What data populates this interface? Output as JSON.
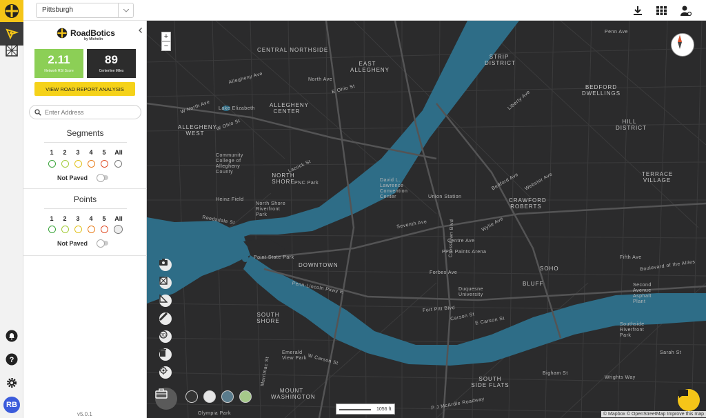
{
  "topbar": {
    "city": "Pittsburgh",
    "icons": [
      "download-icon",
      "grid-icon",
      "user-settings-icon"
    ]
  },
  "panel": {
    "brand_name": "RoadBotics",
    "brand_sub": "by Michelin",
    "stats": [
      {
        "value": "2.11",
        "label": "Network RSI Score",
        "color": "#8ccf56"
      },
      {
        "value": "89",
        "label": "Centerline Miles",
        "color": "#2c2c2c"
      }
    ],
    "report_button": "VIEW ROAD REPORT ANALYSIS",
    "address_placeholder": "Enter Address",
    "segments": {
      "title": "Segments",
      "levels": [
        "1",
        "2",
        "3",
        "4",
        "5",
        "All"
      ],
      "colors": [
        "#3aa43a",
        "#a4cc3a",
        "#e2c21d",
        "#e87f1e",
        "#e0502a",
        "#7a7a7a"
      ],
      "toggle_label": "Not Paved"
    },
    "points": {
      "title": "Points",
      "levels": [
        "1",
        "2",
        "3",
        "4",
        "5",
        "All"
      ],
      "colors": [
        "#3aa43a",
        "#a4cc3a",
        "#e2c21d",
        "#e87f1e",
        "#e0502a",
        "#7a7a7a"
      ],
      "toggle_label": "Not Paved"
    },
    "version": "v5.0.1"
  },
  "rail": {
    "avatar": "RB"
  },
  "map": {
    "zoom_in": "+",
    "zoom_out": "−",
    "scale": "1056 ft",
    "attribution": "© Mapbox © OpenStreetMap  Improve this map",
    "colors": {
      "land": "#2b2b2c",
      "water": "#2e6d87",
      "road": "#454545"
    },
    "labels": [
      {
        "text": "CENTRAL NORTHSIDE",
        "big": true
      },
      {
        "text": "EAST ALLEGHENY",
        "big": true
      },
      {
        "text": "STRIP DISTRICT",
        "big": true
      },
      {
        "text": "BEDFORD DWELLINGS",
        "big": true
      },
      {
        "text": "ALLEGHENY CENTER",
        "big": true
      },
      {
        "text": "ALLEGHENY WEST",
        "big": true
      },
      {
        "text": "HILL DISTRICT",
        "big": true
      },
      {
        "text": "TERRACE VILLAGE",
        "big": true
      },
      {
        "text": "NORTH SHORE",
        "big": true
      },
      {
        "text": "CRAWFORD ROBERTS",
        "big": true
      },
      {
        "text": "DOWNTOWN",
        "big": true
      },
      {
        "text": "BLUFF",
        "big": true
      },
      {
        "text": "SOHO",
        "big": true
      },
      {
        "text": "SOUTH SHORE",
        "big": true
      },
      {
        "text": "SOUTH SIDE FLATS",
        "big": true
      },
      {
        "text": "MOUNT WASHINGTON",
        "big": true
      },
      {
        "text": "Point State Park",
        "big": false
      },
      {
        "text": "North Shore Riverfront Park",
        "big": false
      },
      {
        "text": "PNC Park",
        "big": false
      },
      {
        "text": "David L. Lawrence Convention Center",
        "big": false
      },
      {
        "text": "Union Station",
        "big": false
      },
      {
        "text": "PPG Paints Arena",
        "big": false
      },
      {
        "text": "Duquesne University",
        "big": false
      },
      {
        "text": "Southside Riverfront Park",
        "big": false
      },
      {
        "text": "Second Avenue Asphalt Plant",
        "big": false
      },
      {
        "text": "Community College of Allegheny County",
        "big": false
      },
      {
        "text": "Heinz Field",
        "big": false
      },
      {
        "text": "Lake Elizabeth",
        "big": false
      },
      {
        "text": "Penn Ave",
        "big": false
      },
      {
        "text": "Liberty Ave",
        "big": false
      },
      {
        "text": "Fifth Ave",
        "big": false
      },
      {
        "text": "Forbes Ave",
        "big": false
      },
      {
        "text": "Boulevard of the Allies",
        "big": false
      },
      {
        "text": "Centre Ave",
        "big": false
      },
      {
        "text": "Bedford Ave",
        "big": false
      },
      {
        "text": "Webster Ave",
        "big": false
      },
      {
        "text": "Wylie Ave",
        "big": false
      },
      {
        "text": "Crosstown Blvd",
        "big": false
      },
      {
        "text": "Seventh Ave",
        "big": false
      },
      {
        "text": "Carson St",
        "big": false
      },
      {
        "text": "W Carson St",
        "big": false
      },
      {
        "text": "E Carson St",
        "big": false
      },
      {
        "text": "Penn-Lincoln Pkwy E",
        "big": false
      },
      {
        "text": "Fort Pitt Blvd",
        "big": false
      },
      {
        "text": "Reedsdale St",
        "big": false
      },
      {
        "text": "North Ave",
        "big": false
      },
      {
        "text": "W North Ave",
        "big": false
      },
      {
        "text": "W Ohio St",
        "big": false
      },
      {
        "text": "E Ohio St",
        "big": false
      },
      {
        "text": "Allegheny Ave",
        "big": false
      },
      {
        "text": "Lacock St",
        "big": false
      },
      {
        "text": "Merrimac St",
        "big": false
      },
      {
        "text": "P J McArdle Roadway",
        "big": false
      },
      {
        "text": "Bigham St",
        "big": false
      },
      {
        "text": "Wrights Way",
        "big": false
      },
      {
        "text": "Sarah St",
        "big": false
      },
      {
        "text": "Olympia Park",
        "big": false
      },
      {
        "text": "Emerald View Park",
        "big": false
      }
    ]
  }
}
